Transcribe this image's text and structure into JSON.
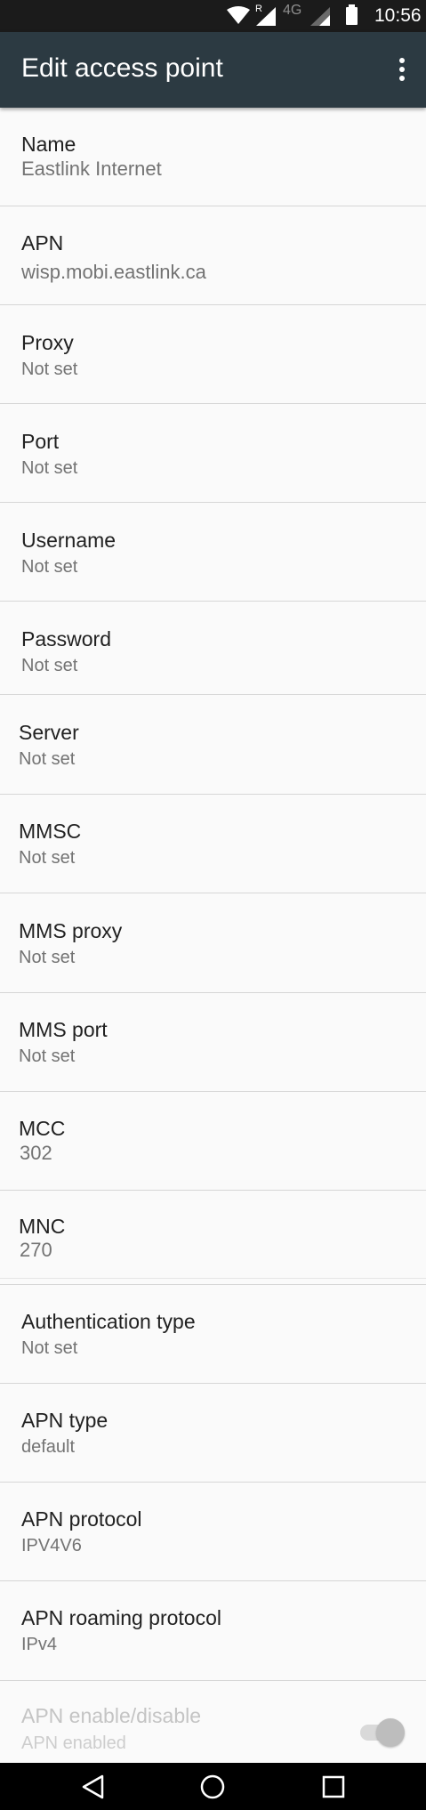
{
  "status_bar": {
    "roaming_label": "R",
    "network_type": "4G",
    "time": "10:56",
    "icons": [
      "wifi-icon",
      "signal-icon",
      "signal-icon",
      "battery-icon"
    ]
  },
  "toolbar": {
    "title": "Edit access point",
    "menu_icon": "more-vert-icon"
  },
  "items": [
    {
      "label": "Name",
      "value": "Eastlink Internet"
    },
    {
      "label": "APN",
      "value": "wisp.mobi.eastlink.ca"
    },
    {
      "label": "Proxy",
      "value": "Not set"
    },
    {
      "label": "Port",
      "value": "Not set"
    },
    {
      "label": "Username",
      "value": "Not set"
    },
    {
      "label": "Password",
      "value": "Not set"
    },
    {
      "label": "Server",
      "value": "Not set"
    },
    {
      "label": "MMSC",
      "value": "Not set"
    },
    {
      "label": "MMS proxy",
      "value": "Not set"
    },
    {
      "label": "MMS port",
      "value": "Not set"
    },
    {
      "label": "MCC",
      "value": "302"
    },
    {
      "label": "MNC",
      "value": "270"
    },
    {
      "label": "Authentication type",
      "value": "Not set"
    },
    {
      "label": "APN type",
      "value": "default"
    },
    {
      "label": "APN protocol",
      "value": "IPV4V6"
    },
    {
      "label": "APN roaming protocol",
      "value": "IPv4"
    },
    {
      "label": "APN enable/disable",
      "value": "APN enabled",
      "toggle_on": true,
      "disabled": true
    }
  ],
  "nav_bar": {
    "icons": [
      "back-icon",
      "home-icon",
      "recents-icon"
    ]
  }
}
